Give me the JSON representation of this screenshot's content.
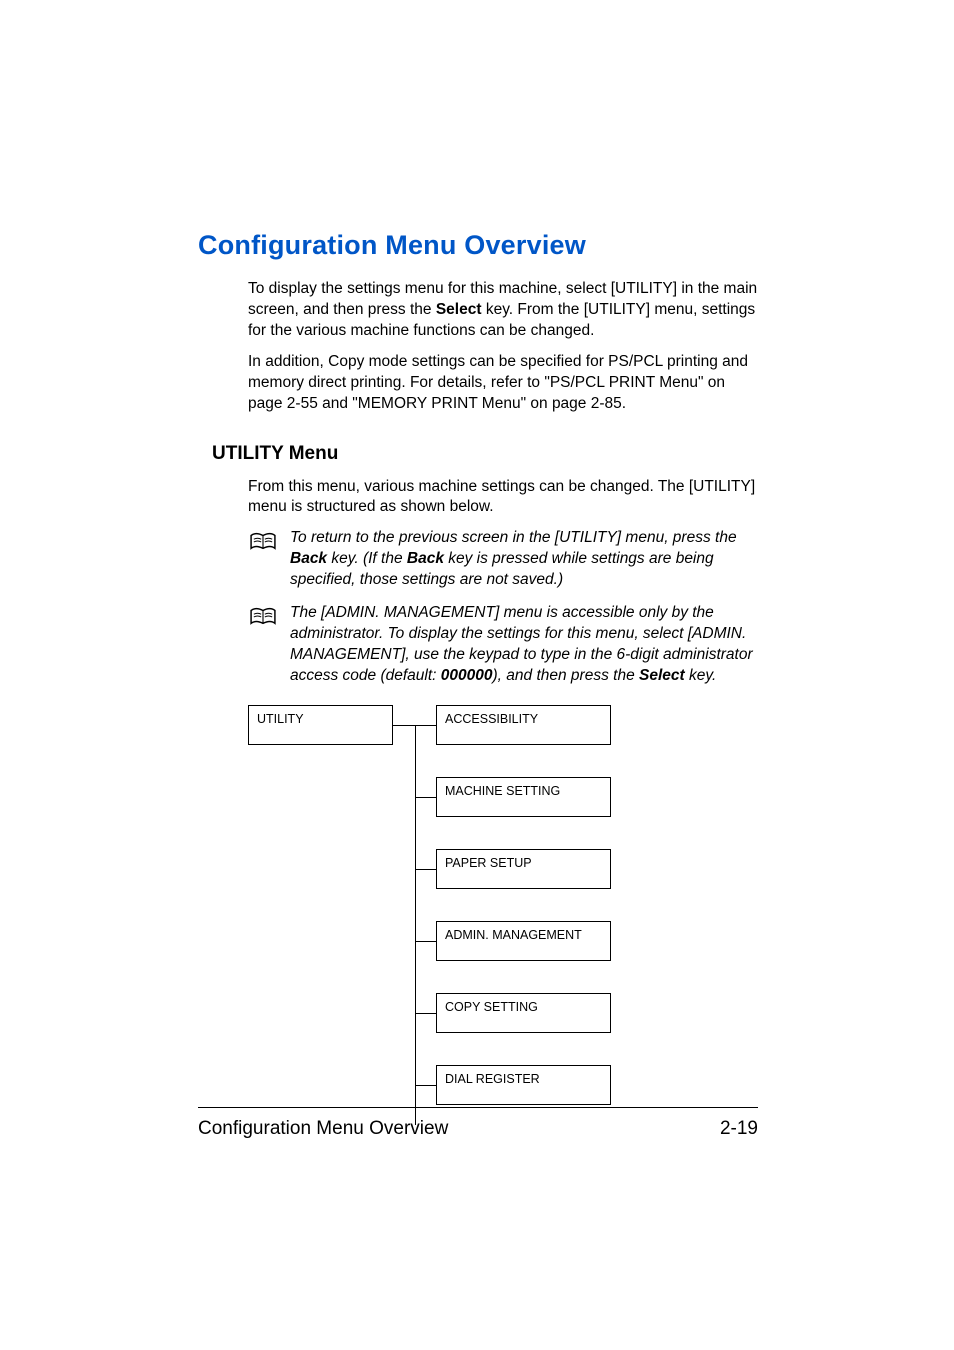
{
  "title": "Configuration Menu Overview",
  "intro1_a": "To display the settings menu for this machine, select [UTILITY] in the main screen, and then press the ",
  "intro1_bold": "Select",
  "intro1_b": " key. From the [UTILITY] menu, settings for the various machine functions can be changed.",
  "intro2": "In addition, Copy mode settings can be specified for PS/PCL printing and memory direct printing. For details, refer to \"PS/PCL PRINT Menu\" on page 2-55 and \"MEMORY PRINT Menu\" on page 2-85.",
  "subhead": "UTILITY Menu",
  "sub_intro": "From this menu, various machine settings can be changed. The [UTILITY] menu is structured as shown below.",
  "note1_a": "To return to the previous screen in the [UTILITY] menu, press the ",
  "note1_back1": "Back",
  "note1_b": " key. (If the ",
  "note1_back2": "Back",
  "note1_c": " key is pressed while settings are being specified, those settings are not saved.)",
  "note2_a": "The [ADMIN. MANAGEMENT] menu is accessible only by the administrator. To display the settings for this menu, select [ADMIN. MANAGEMENT], use the keypad to type in the 6-digit administrator access code (default: ",
  "note2_code": "000000",
  "note2_b": "), and then press the ",
  "note2_select": "Select",
  "note2_c": " key.",
  "tree": {
    "root": "UTILITY",
    "children": [
      "ACCESSIBILITY",
      "MACHINE SETTING",
      "PAPER SETUP",
      "ADMIN. MANAGEMENT",
      "COPY SETTING",
      "DIAL REGISTER"
    ]
  },
  "footer_left": "Configuration Menu Overview",
  "footer_right": "2-19"
}
